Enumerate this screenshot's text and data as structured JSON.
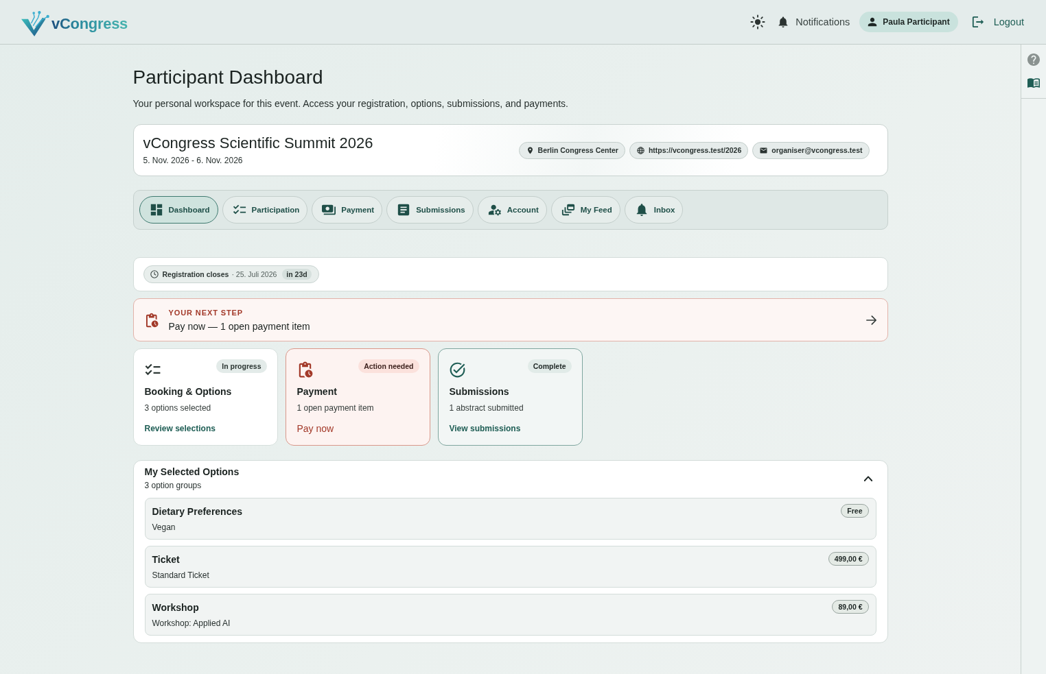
{
  "header": {
    "logo": "vCongress",
    "notifications": "Notifications",
    "user": "Paula Participant",
    "logout": "Logout"
  },
  "page": {
    "title": "Participant Dashboard",
    "subtitle": "Your personal workspace for this event. Access your registration, options, submissions, and payments."
  },
  "event": {
    "title": "vCongress Scientific Summit 2026",
    "dates": "5. Nov. 2026 - 6. Nov. 2026",
    "chips": [
      {
        "kind": "location",
        "label": "Berlin Congress Center"
      },
      {
        "kind": "website",
        "label": "https://vcongress.test/2026"
      },
      {
        "kind": "email",
        "label": "organiser@vcongress.test"
      }
    ]
  },
  "tabs": [
    {
      "label": "Dashboard",
      "selected": true
    },
    {
      "label": "Participation",
      "selected": false
    },
    {
      "label": "Payment",
      "selected": false
    },
    {
      "label": "Submissions",
      "selected": false
    },
    {
      "label": "Account",
      "selected": false
    },
    {
      "label": "My Feed",
      "selected": false
    },
    {
      "label": "Inbox",
      "selected": false
    }
  ],
  "registration": {
    "label": "Registration closes",
    "date": "· 25. Juli 2026",
    "countdown": "in 23d"
  },
  "next_step": {
    "label": "YOUR NEXT STEP",
    "text": "Pay now — 1 open payment item"
  },
  "cards": [
    {
      "kind": "progress",
      "status": "In progress",
      "title": "Booking & Options",
      "description": "3 options selected",
      "link": "Review selections"
    },
    {
      "kind": "action",
      "status": "Action needed",
      "title": "Payment",
      "description": "1 open payment item",
      "link": "Pay now"
    },
    {
      "kind": "complete",
      "status": "Complete",
      "title": "Submissions",
      "description": "1 abstract submitted",
      "link": "View submissions"
    }
  ],
  "options": {
    "title": "My Selected Options",
    "count": "3 option groups",
    "expanded": true,
    "items": [
      {
        "name": "Dietary Preferences",
        "value": "Vegan",
        "price": "Free"
      },
      {
        "name": "Ticket",
        "value": "Standard Ticket",
        "price": "499,00 €"
      },
      {
        "name": "Workshop",
        "value": "Workshop: Applied AI",
        "price": "89,00 €"
      }
    ]
  }
}
